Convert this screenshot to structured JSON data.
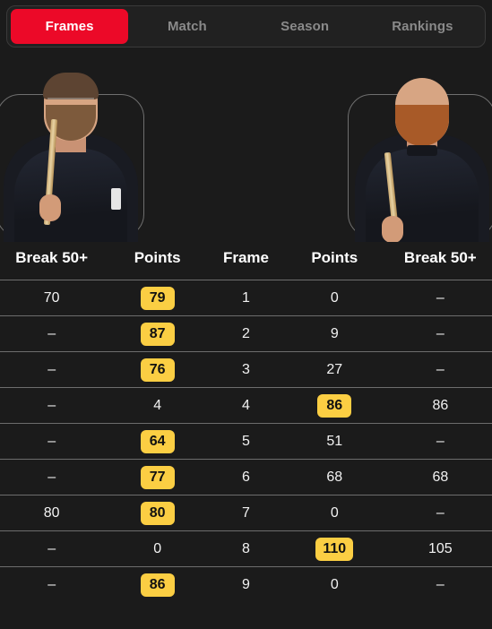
{
  "tabs": [
    {
      "label": "Frames",
      "active": true
    },
    {
      "label": "Match",
      "active": false
    },
    {
      "label": "Season",
      "active": false
    },
    {
      "label": "Rankings",
      "active": false
    }
  ],
  "players": {
    "left": {
      "alt": "left-player-photo"
    },
    "right": {
      "alt": "right-player-photo"
    }
  },
  "table": {
    "headers": [
      "Break 50+",
      "Points",
      "Frame",
      "Points",
      "Break 50+"
    ],
    "rows": [
      {
        "left_break": "70",
        "left_points": "79",
        "left_highlight": true,
        "frame": "1",
        "right_points": "0",
        "right_highlight": false,
        "right_break": "–"
      },
      {
        "left_break": "–",
        "left_points": "87",
        "left_highlight": true,
        "frame": "2",
        "right_points": "9",
        "right_highlight": false,
        "right_break": "–"
      },
      {
        "left_break": "–",
        "left_points": "76",
        "left_highlight": true,
        "frame": "3",
        "right_points": "27",
        "right_highlight": false,
        "right_break": "–"
      },
      {
        "left_break": "–",
        "left_points": "4",
        "left_highlight": false,
        "frame": "4",
        "right_points": "86",
        "right_highlight": true,
        "right_break": "86"
      },
      {
        "left_break": "–",
        "left_points": "64",
        "left_highlight": true,
        "frame": "5",
        "right_points": "51",
        "right_highlight": false,
        "right_break": "–"
      },
      {
        "left_break": "–",
        "left_points": "77",
        "left_highlight": true,
        "frame": "6",
        "right_points": "68",
        "right_highlight": false,
        "right_break": "68"
      },
      {
        "left_break": "80",
        "left_points": "80",
        "left_highlight": true,
        "frame": "7",
        "right_points": "0",
        "right_highlight": false,
        "right_break": "–"
      },
      {
        "left_break": "–",
        "left_points": "0",
        "left_highlight": false,
        "frame": "8",
        "right_points": "110",
        "right_highlight": true,
        "right_break": "105"
      },
      {
        "left_break": "–",
        "left_points": "86",
        "left_highlight": true,
        "frame": "9",
        "right_points": "0",
        "right_highlight": false,
        "right_break": "–"
      }
    ]
  },
  "colors": {
    "background": "#1b1b1b",
    "active_tab": "#ec0928",
    "badge": "#fbce43",
    "inactive_tab_text": "#8a8a8a",
    "row_divider": "#6d6d6d"
  }
}
